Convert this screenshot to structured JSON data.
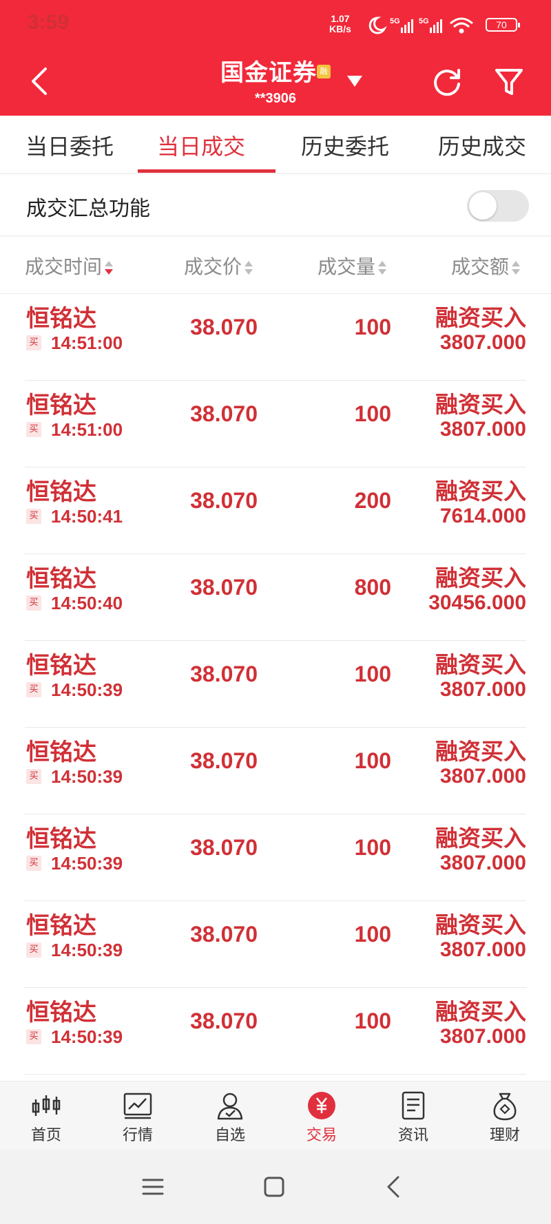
{
  "status": {
    "time": "3:59",
    "net_speed_value": "1.07",
    "net_speed_unit": "KB/s",
    "battery": "70"
  },
  "header": {
    "title": "国金证券",
    "badge": "融",
    "account": "**3906"
  },
  "tabs": [
    {
      "label": "当日委托"
    },
    {
      "label": "当日成交"
    },
    {
      "label": "历史委托"
    },
    {
      "label": "历史成交"
    }
  ],
  "summary": {
    "label": "成交汇总功能",
    "enabled": false
  },
  "table": {
    "headers": [
      "成交时间",
      "成交价",
      "成交量",
      "成交额"
    ],
    "rows": [
      {
        "stock": "恒铭达",
        "tag": "买",
        "time": "14:51:00",
        "price": "38.070",
        "qty": "100",
        "type": "融资买入",
        "amount": "3807.000"
      },
      {
        "stock": "恒铭达",
        "tag": "买",
        "time": "14:51:00",
        "price": "38.070",
        "qty": "100",
        "type": "融资买入",
        "amount": "3807.000"
      },
      {
        "stock": "恒铭达",
        "tag": "买",
        "time": "14:50:41",
        "price": "38.070",
        "qty": "200",
        "type": "融资买入",
        "amount": "7614.000"
      },
      {
        "stock": "恒铭达",
        "tag": "买",
        "time": "14:50:40",
        "price": "38.070",
        "qty": "800",
        "type": "融资买入",
        "amount": "30456.000"
      },
      {
        "stock": "恒铭达",
        "tag": "买",
        "time": "14:50:39",
        "price": "38.070",
        "qty": "100",
        "type": "融资买入",
        "amount": "3807.000"
      },
      {
        "stock": "恒铭达",
        "tag": "买",
        "time": "14:50:39",
        "price": "38.070",
        "qty": "100",
        "type": "融资买入",
        "amount": "3807.000"
      },
      {
        "stock": "恒铭达",
        "tag": "买",
        "time": "14:50:39",
        "price": "38.070",
        "qty": "100",
        "type": "融资买入",
        "amount": "3807.000"
      },
      {
        "stock": "恒铭达",
        "tag": "买",
        "time": "14:50:39",
        "price": "38.070",
        "qty": "100",
        "type": "融资买入",
        "amount": "3807.000"
      },
      {
        "stock": "恒铭达",
        "tag": "买",
        "time": "14:50:39",
        "price": "38.070",
        "qty": "100",
        "type": "融资买入",
        "amount": "3807.000"
      }
    ]
  },
  "bottom_nav": [
    {
      "label": "首页",
      "icon": "candlestick-icon"
    },
    {
      "label": "行情",
      "icon": "market-chart-icon"
    },
    {
      "label": "自选",
      "icon": "watchlist-user-icon"
    },
    {
      "label": "交易",
      "icon": "yuan-icon"
    },
    {
      "label": "资讯",
      "icon": "news-doc-icon"
    },
    {
      "label": "理财",
      "icon": "money-bag-icon"
    }
  ],
  "colors": {
    "brand_red": "#f2293a",
    "accent": "#e0303d",
    "row_text": "#d03036"
  }
}
